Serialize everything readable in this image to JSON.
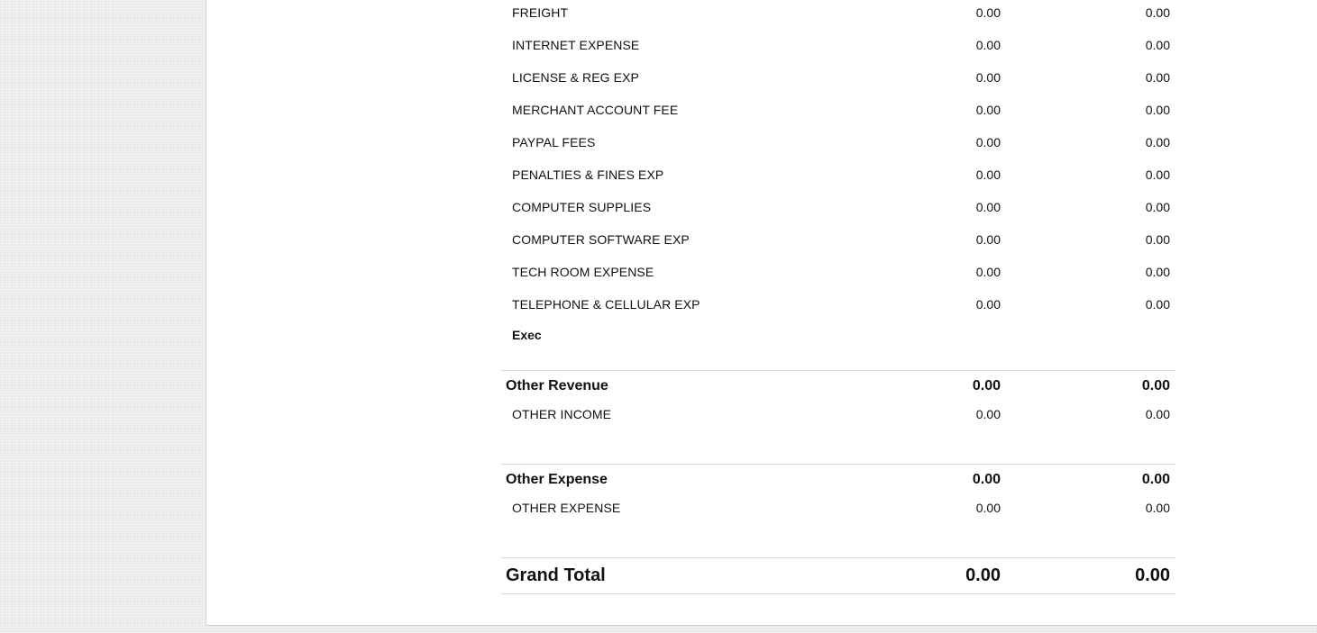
{
  "expense_rows": [
    {
      "label": "FREIGHT",
      "col1": "0.00",
      "col2": "0.00"
    },
    {
      "label": "INTERNET EXPENSE",
      "col1": "0.00",
      "col2": "0.00"
    },
    {
      "label": "LICENSE & REG EXP",
      "col1": "0.00",
      "col2": "0.00"
    },
    {
      "label": "MERCHANT ACCOUNT FEE",
      "col1": "0.00",
      "col2": "0.00"
    },
    {
      "label": "PAYPAL FEES",
      "col1": "0.00",
      "col2": "0.00"
    },
    {
      "label": "PENALTIES & FINES EXP",
      "col1": "0.00",
      "col2": "0.00"
    },
    {
      "label": "COMPUTER SUPPLIES",
      "col1": "0.00",
      "col2": "0.00"
    },
    {
      "label": "COMPUTER SOFTWARE EXP",
      "col1": "0.00",
      "col2": "0.00"
    },
    {
      "label": "TECH ROOM EXPENSE",
      "col1": "0.00",
      "col2": "0.00"
    },
    {
      "label": "TELEPHONE & CELLULAR EXP",
      "col1": "0.00",
      "col2": "0.00"
    }
  ],
  "exec_subheading": "Exec",
  "other_revenue": {
    "title": "Other Revenue",
    "total1": "0.00",
    "total2": "0.00",
    "rows": [
      {
        "label": "OTHER INCOME",
        "col1": "0.00",
        "col2": "0.00"
      }
    ]
  },
  "other_expense": {
    "title": "Other Expense",
    "total1": "0.00",
    "total2": "0.00",
    "rows": [
      {
        "label": "OTHER EXPENSE",
        "col1": "0.00",
        "col2": "0.00"
      }
    ]
  },
  "grand_total": {
    "label": "Grand Total",
    "total1": "0.00",
    "total2": "0.00"
  }
}
